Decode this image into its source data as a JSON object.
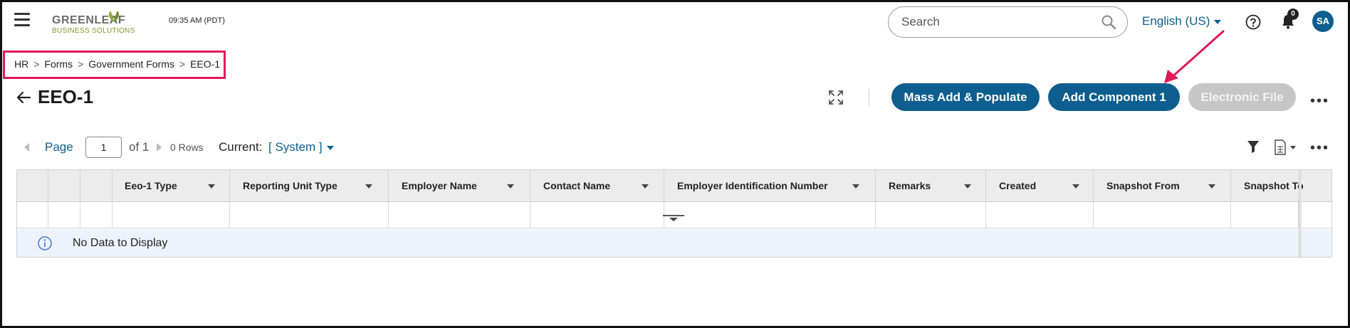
{
  "header": {
    "logo_top": "GREENLEAF",
    "logo_bottom": "BUSINESS SOLUTIONS",
    "time": "09:35 AM (PDT)",
    "search_placeholder": "Search",
    "language": "English (US)",
    "notification_count": "0",
    "avatar_initials": "SA"
  },
  "breadcrumb": {
    "items": [
      "HR",
      "Forms",
      "Government Forms",
      "EEO-1"
    ],
    "separator": ">"
  },
  "title": "EEO-1",
  "actions": {
    "mass_add": "Mass Add & Populate",
    "add_component": "Add Component 1",
    "electronic_file": "Electronic File",
    "more": "•••"
  },
  "pager": {
    "page_label": "Page",
    "page_value": "1",
    "of_label": "of 1",
    "rows_label": "0 Rows",
    "current_label": "Current:",
    "current_value": "[ System ]"
  },
  "grid": {
    "columns": [
      "Eeo-1 Type",
      "Reporting Unit Type",
      "Employer Name",
      "Contact Name",
      "Employer Identification Number",
      "Remarks",
      "Created",
      "Snapshot From",
      "Snapshot To"
    ],
    "empty_message": "No Data to Display"
  },
  "colors": {
    "primary": "#0d5e8e",
    "highlight_box": "#e0195a",
    "disabled": "#c6c6c6"
  }
}
